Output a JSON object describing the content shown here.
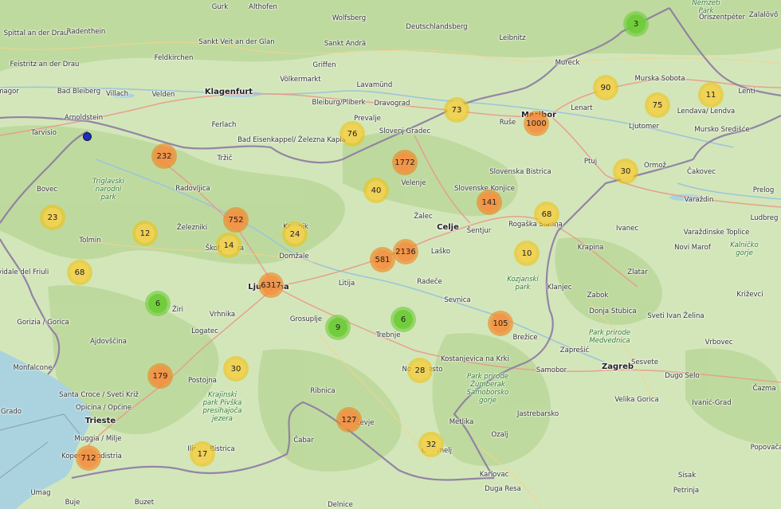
{
  "map": {
    "place_labels": [
      {
        "id": "gurk",
        "text": "Gurk"
      },
      {
        "id": "althofen",
        "text": "Althofen"
      },
      {
        "id": "wolfsberg",
        "text": "Wolfsberg"
      },
      {
        "id": "deutschlandsberg",
        "text": "Deutschlandsberg"
      },
      {
        "id": "nemzeti-park",
        "text": "Nemzeti\nPark"
      },
      {
        "id": "oriszentpeter",
        "text": "Őriszentpéter"
      },
      {
        "id": "zalalovo",
        "text": "Zalalövő"
      },
      {
        "id": "spittal",
        "text": "Spittal\nan der Drau"
      },
      {
        "id": "radenthein",
        "text": "Radenthein"
      },
      {
        "id": "sankt-veit",
        "text": "Sankt Veit\nan der Glan"
      },
      {
        "id": "sankt-andra",
        "text": "Sankt Andrä"
      },
      {
        "id": "leibnitz",
        "text": "Leibnitz"
      },
      {
        "id": "feistritz",
        "text": "Feistritz\nan der Drau"
      },
      {
        "id": "feldkirchen",
        "text": "Feldkirchen"
      },
      {
        "id": "griffen",
        "text": "Griffen"
      },
      {
        "id": "mureck",
        "text": "Mureck"
      },
      {
        "id": "volkermarkt",
        "text": "Völkermarkt"
      },
      {
        "id": "murska-sobota",
        "text": "Murska Sobota"
      },
      {
        "id": "magor",
        "text": "magor"
      },
      {
        "id": "bad-bleiberg",
        "text": "Bad Bleiberg"
      },
      {
        "id": "villach",
        "text": "Villach"
      },
      {
        "id": "velden",
        "text": "Velden"
      },
      {
        "id": "klagenfurt",
        "text": "Klagenfurt"
      },
      {
        "id": "lavamund",
        "text": "Lavamünd"
      },
      {
        "id": "bleiburg",
        "text": "Bleiburg/Pliberk"
      },
      {
        "id": "dravograd",
        "text": "Dravograd"
      },
      {
        "id": "lenart",
        "text": "Lenart"
      },
      {
        "id": "lenti",
        "text": "Lenti"
      },
      {
        "id": "arnoldstein",
        "text": "Arnoldstein"
      },
      {
        "id": "tarvisio",
        "text": "Tarvisio"
      },
      {
        "id": "ferlach",
        "text": "Ferlach"
      },
      {
        "id": "prevalje",
        "text": "Prevalje"
      },
      {
        "id": "slovenj-gradec",
        "text": "Slovenj Gradec"
      },
      {
        "id": "maribor",
        "text": "Maribor"
      },
      {
        "id": "ruse",
        "text": "Ruše"
      },
      {
        "id": "ljutomer",
        "text": "Ljutomer"
      },
      {
        "id": "lendava",
        "text": "Lendava/\nLendva"
      },
      {
        "id": "mursko-sredisce",
        "text": "Mursko Središće"
      },
      {
        "id": "bad-eisenkappel",
        "text": "Bad Eisenkappel/\nŽelezna Kapla"
      },
      {
        "id": "ptuj",
        "text": "Ptuj"
      },
      {
        "id": "ormoz",
        "text": "Ormož"
      },
      {
        "id": "cakovec",
        "text": "Čakovec"
      },
      {
        "id": "trzic",
        "text": "Tržič"
      },
      {
        "id": "velenje",
        "text": "Velenje"
      },
      {
        "id": "slovenska-bistrica",
        "text": "Slovenska\nBistrica"
      },
      {
        "id": "slovenske-konjice",
        "text": "Slovenske\nKonjice"
      },
      {
        "id": "bovec",
        "text": "Bovec"
      },
      {
        "id": "radovljica",
        "text": "Radovljica"
      },
      {
        "id": "varazdin",
        "text": "Varaždin"
      },
      {
        "id": "prelog",
        "text": "Prelog"
      },
      {
        "id": "triglavski",
        "text": "Triglavski\nnarodni\npark"
      },
      {
        "id": "zalec",
        "text": "Žalec"
      },
      {
        "id": "celje",
        "text": "Celje"
      },
      {
        "id": "sentjur",
        "text": "Šentjur"
      },
      {
        "id": "ludbreg",
        "text": "Ludbreg"
      },
      {
        "id": "kamnik",
        "text": "Kamnik"
      },
      {
        "id": "zelezniki",
        "text": "Železniki"
      },
      {
        "id": "rogaska",
        "text": "Rogaška Slatina"
      },
      {
        "id": "ivanec",
        "text": "Ivanec"
      },
      {
        "id": "varazdinske",
        "text": "Varaždinske\nToplice"
      },
      {
        "id": "tolmin",
        "text": "Tolmin"
      },
      {
        "id": "skofja-loka",
        "text": "Škofja Loka"
      },
      {
        "id": "kalnicko",
        "text": "Kalničko\ngorje"
      },
      {
        "id": "domzale",
        "text": "Domžale"
      },
      {
        "id": "lasko",
        "text": "Laško"
      },
      {
        "id": "krapina",
        "text": "Krapina"
      },
      {
        "id": "novi-marof",
        "text": "Novi Marof"
      },
      {
        "id": "cividale",
        "text": "Cividale del\nFriuli"
      },
      {
        "id": "kozjanski",
        "text": "Kozjanski\npark"
      },
      {
        "id": "klanjec",
        "text": "Klanjec"
      },
      {
        "id": "zlatar",
        "text": "Zlatar"
      },
      {
        "id": "ljubljana",
        "text": "Ljubljana"
      },
      {
        "id": "litija",
        "text": "Litija"
      },
      {
        "id": "radece",
        "text": "Radeče"
      },
      {
        "id": "ziri",
        "text": "Žiri"
      },
      {
        "id": "zabok",
        "text": "Zabok"
      },
      {
        "id": "krizevci",
        "text": "Križevci"
      },
      {
        "id": "sevnica",
        "text": "Sevnica"
      },
      {
        "id": "vrhnika",
        "text": "Vrhnika"
      },
      {
        "id": "donja-stubica",
        "text": "Donja Stubica"
      },
      {
        "id": "sveti-ivan",
        "text": "Sveti Ivan\nŽelina"
      },
      {
        "id": "gorizia",
        "text": "Gorizia / Gorica"
      },
      {
        "id": "grosuplje",
        "text": "Grosuplje"
      },
      {
        "id": "park-medvednica",
        "text": "Park prirode\nMedvednica"
      },
      {
        "id": "logatec",
        "text": "Logatec"
      },
      {
        "id": "brezice",
        "text": "Brežice"
      },
      {
        "id": "vrbovec",
        "text": "Vrbovec"
      },
      {
        "id": "ajdovscina",
        "text": "Ajdovščina"
      },
      {
        "id": "trebnje",
        "text": "Trebnje"
      },
      {
        "id": "zapresic",
        "text": "Zaprešić"
      },
      {
        "id": "kostanjevica",
        "text": "Kostanjevica\nna Krki"
      },
      {
        "id": "sesvete",
        "text": "Sesvete"
      },
      {
        "id": "monfalcone",
        "text": "Monfalcone"
      },
      {
        "id": "novo-mesto",
        "text": "Novo mesto"
      },
      {
        "id": "samobor",
        "text": "Samobor"
      },
      {
        "id": "zagreb",
        "text": "Zagreb"
      },
      {
        "id": "dugo-selo",
        "text": "Dugo Selo"
      },
      {
        "id": "postojna",
        "text": "Postojna"
      },
      {
        "id": "santa-croce",
        "text": "Santa Croce /\nSveti Križ"
      },
      {
        "id": "krajinski",
        "text": "Krajinski\npark Pivška\npresihajoča\njezera"
      },
      {
        "id": "zumberak",
        "text": "Park prirode\nŽumberak\nSamoborsko\ngorje"
      },
      {
        "id": "velika-gorica",
        "text": "Velika Gorica"
      },
      {
        "id": "cazma",
        "text": "Čazma"
      },
      {
        "id": "grado",
        "text": "Grado"
      },
      {
        "id": "opicina",
        "text": "Opicina / Općine"
      },
      {
        "id": "trieste",
        "text": "Trieste"
      },
      {
        "id": "ribnica",
        "text": "Ribnica"
      },
      {
        "id": "ivanic-grad",
        "text": "Ivanić-Grad"
      },
      {
        "id": "kocevje",
        "text": "Kočevje"
      },
      {
        "id": "metlika",
        "text": "Metlika"
      },
      {
        "id": "jastrebarsko",
        "text": "Jastrebarsko"
      },
      {
        "id": "muggia",
        "text": "Muggia / Milje"
      },
      {
        "id": "ozalj",
        "text": "Ozalj"
      },
      {
        "id": "popovaca",
        "text": "Popovača"
      },
      {
        "id": "koper",
        "text": "Koper/Capodistria"
      },
      {
        "id": "ilirska-bistrica",
        "text": "Ilirska Bistrica"
      },
      {
        "id": "cabar",
        "text": "Čabar"
      },
      {
        "id": "crnomelj",
        "text": "Črnomelj"
      },
      {
        "id": "karlovac",
        "text": "Karlovac"
      },
      {
        "id": "sisak",
        "text": "Sisak"
      },
      {
        "id": "umag",
        "text": "Umag"
      },
      {
        "id": "buje",
        "text": "Buje"
      },
      {
        "id": "buzet",
        "text": "Buzet"
      },
      {
        "id": "delnice",
        "text": "Delnice"
      },
      {
        "id": "duga-resa",
        "text": "Duga Resa"
      },
      {
        "id": "petrinja",
        "text": "Petrinja"
      }
    ],
    "clusters": [
      {
        "id": "c3",
        "count": "3",
        "size": "small"
      },
      {
        "id": "c90",
        "count": "90",
        "size": "medium"
      },
      {
        "id": "c75",
        "count": "75",
        "size": "medium"
      },
      {
        "id": "c11",
        "count": "11",
        "size": "medium"
      },
      {
        "id": "c73",
        "count": "73",
        "size": "medium"
      },
      {
        "id": "c1000",
        "count": "1000",
        "size": "large"
      },
      {
        "id": "c76",
        "count": "76",
        "size": "medium"
      },
      {
        "id": "c232",
        "count": "232",
        "size": "large"
      },
      {
        "id": "c1772",
        "count": "1772",
        "size": "large"
      },
      {
        "id": "c30a",
        "count": "30",
        "size": "medium"
      },
      {
        "id": "c40",
        "count": "40",
        "size": "medium"
      },
      {
        "id": "c141",
        "count": "141",
        "size": "large"
      },
      {
        "id": "c23",
        "count": "23",
        "size": "medium"
      },
      {
        "id": "c752",
        "count": "752",
        "size": "large"
      },
      {
        "id": "c68a",
        "count": "68",
        "size": "medium"
      },
      {
        "id": "c12",
        "count": "12",
        "size": "medium"
      },
      {
        "id": "c24",
        "count": "24",
        "size": "medium"
      },
      {
        "id": "c14",
        "count": "14",
        "size": "medium"
      },
      {
        "id": "c2136",
        "count": "2136",
        "size": "large"
      },
      {
        "id": "c581",
        "count": "581",
        "size": "large"
      },
      {
        "id": "c10",
        "count": "10",
        "size": "medium"
      },
      {
        "id": "c68b",
        "count": "68",
        "size": "medium"
      },
      {
        "id": "c6317",
        "count": "6317",
        "size": "large"
      },
      {
        "id": "c6a",
        "count": "6",
        "size": "small"
      },
      {
        "id": "c9",
        "count": "9",
        "size": "small"
      },
      {
        "id": "c6b",
        "count": "6",
        "size": "small"
      },
      {
        "id": "c105",
        "count": "105",
        "size": "large"
      },
      {
        "id": "c179",
        "count": "179",
        "size": "large"
      },
      {
        "id": "c30b",
        "count": "30",
        "size": "medium"
      },
      {
        "id": "c28",
        "count": "28",
        "size": "medium"
      },
      {
        "id": "c127",
        "count": "127",
        "size": "large"
      },
      {
        "id": "c32",
        "count": "32",
        "size": "medium"
      },
      {
        "id": "c17",
        "count": "17",
        "size": "medium"
      },
      {
        "id": "c712",
        "count": "712",
        "size": "large"
      }
    ]
  }
}
